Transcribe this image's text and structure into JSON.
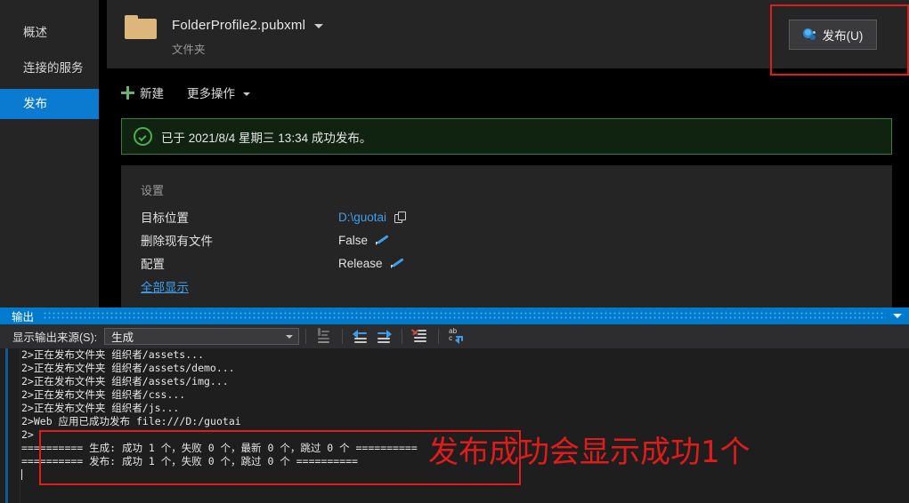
{
  "sidebar": {
    "items": [
      {
        "label": "概述",
        "selected": false
      },
      {
        "label": "连接的服务",
        "selected": false
      },
      {
        "label": "发布",
        "selected": true
      }
    ]
  },
  "header": {
    "profile_name": "FolderProfile2.pubxml",
    "profile_type": "文件夹",
    "folder_icon": "folder-icon",
    "dropdown_icon": "chevron-down-icon"
  },
  "actions": {
    "new_label": "新建",
    "new_icon": "plus-icon",
    "more_label": "更多操作",
    "more_icon": "chevron-down-icon"
  },
  "publish": {
    "button_label": "发布(U)",
    "button_icon": "publish-globe-icon",
    "highlight_color": "#e31b1b"
  },
  "banner": {
    "icon": "success-check-icon",
    "text": "已于 2021/8/4 星期三 13:34 成功发布。",
    "border_color": "#3f7a3f"
  },
  "settings": {
    "title": "设置",
    "rows": [
      {
        "label": "目标位置",
        "value": "D:\\guotai",
        "value_style": "link",
        "icon": "copy-icon"
      },
      {
        "label": "删除现有文件",
        "value": "False",
        "value_style": "plain",
        "icon": "pencil-icon"
      },
      {
        "label": "配置",
        "value": "Release",
        "value_style": "plain",
        "icon": "pencil-icon"
      }
    ],
    "show_all_label": "全部显示"
  },
  "output": {
    "title": "输出",
    "close_icon": "chevron-down-icon",
    "source_label": "显示输出来源(S):",
    "source_value": "生成",
    "toolbar_icons": [
      "clear-pane-icon",
      "go-to-previous-icon",
      "go-to-next-icon",
      "clear-all-icon",
      "word-wrap-icon"
    ],
    "lines": [
      {
        "text": "2>正在发布文件夹 组织者/assets..."
      },
      {
        "text": "2>正在发布文件夹 组织者/assets/demo..."
      },
      {
        "text": "2>正在发布文件夹 组织者/assets/img..."
      },
      {
        "text": "2>正在发布文件夹 组织者/css..."
      },
      {
        "text": "2>正在发布文件夹 组织者/js..."
      },
      {
        "text": "2>Web 应用已成功发布 ",
        "link": "file:///D:/guotai"
      },
      {
        "text": "2>"
      },
      {
        "text": "========== 生成: 成功 1 个，失败 0 个，最新 0 个，跳过 0 个 =========="
      },
      {
        "text": "========== 发布: 成功 1 个，失败 0 个，跳过 0 个 =========="
      },
      {
        "text": "",
        "caret": true
      }
    ]
  },
  "annotation": {
    "text": "发布成功会显示成功1个",
    "color": "#e01b1b"
  }
}
